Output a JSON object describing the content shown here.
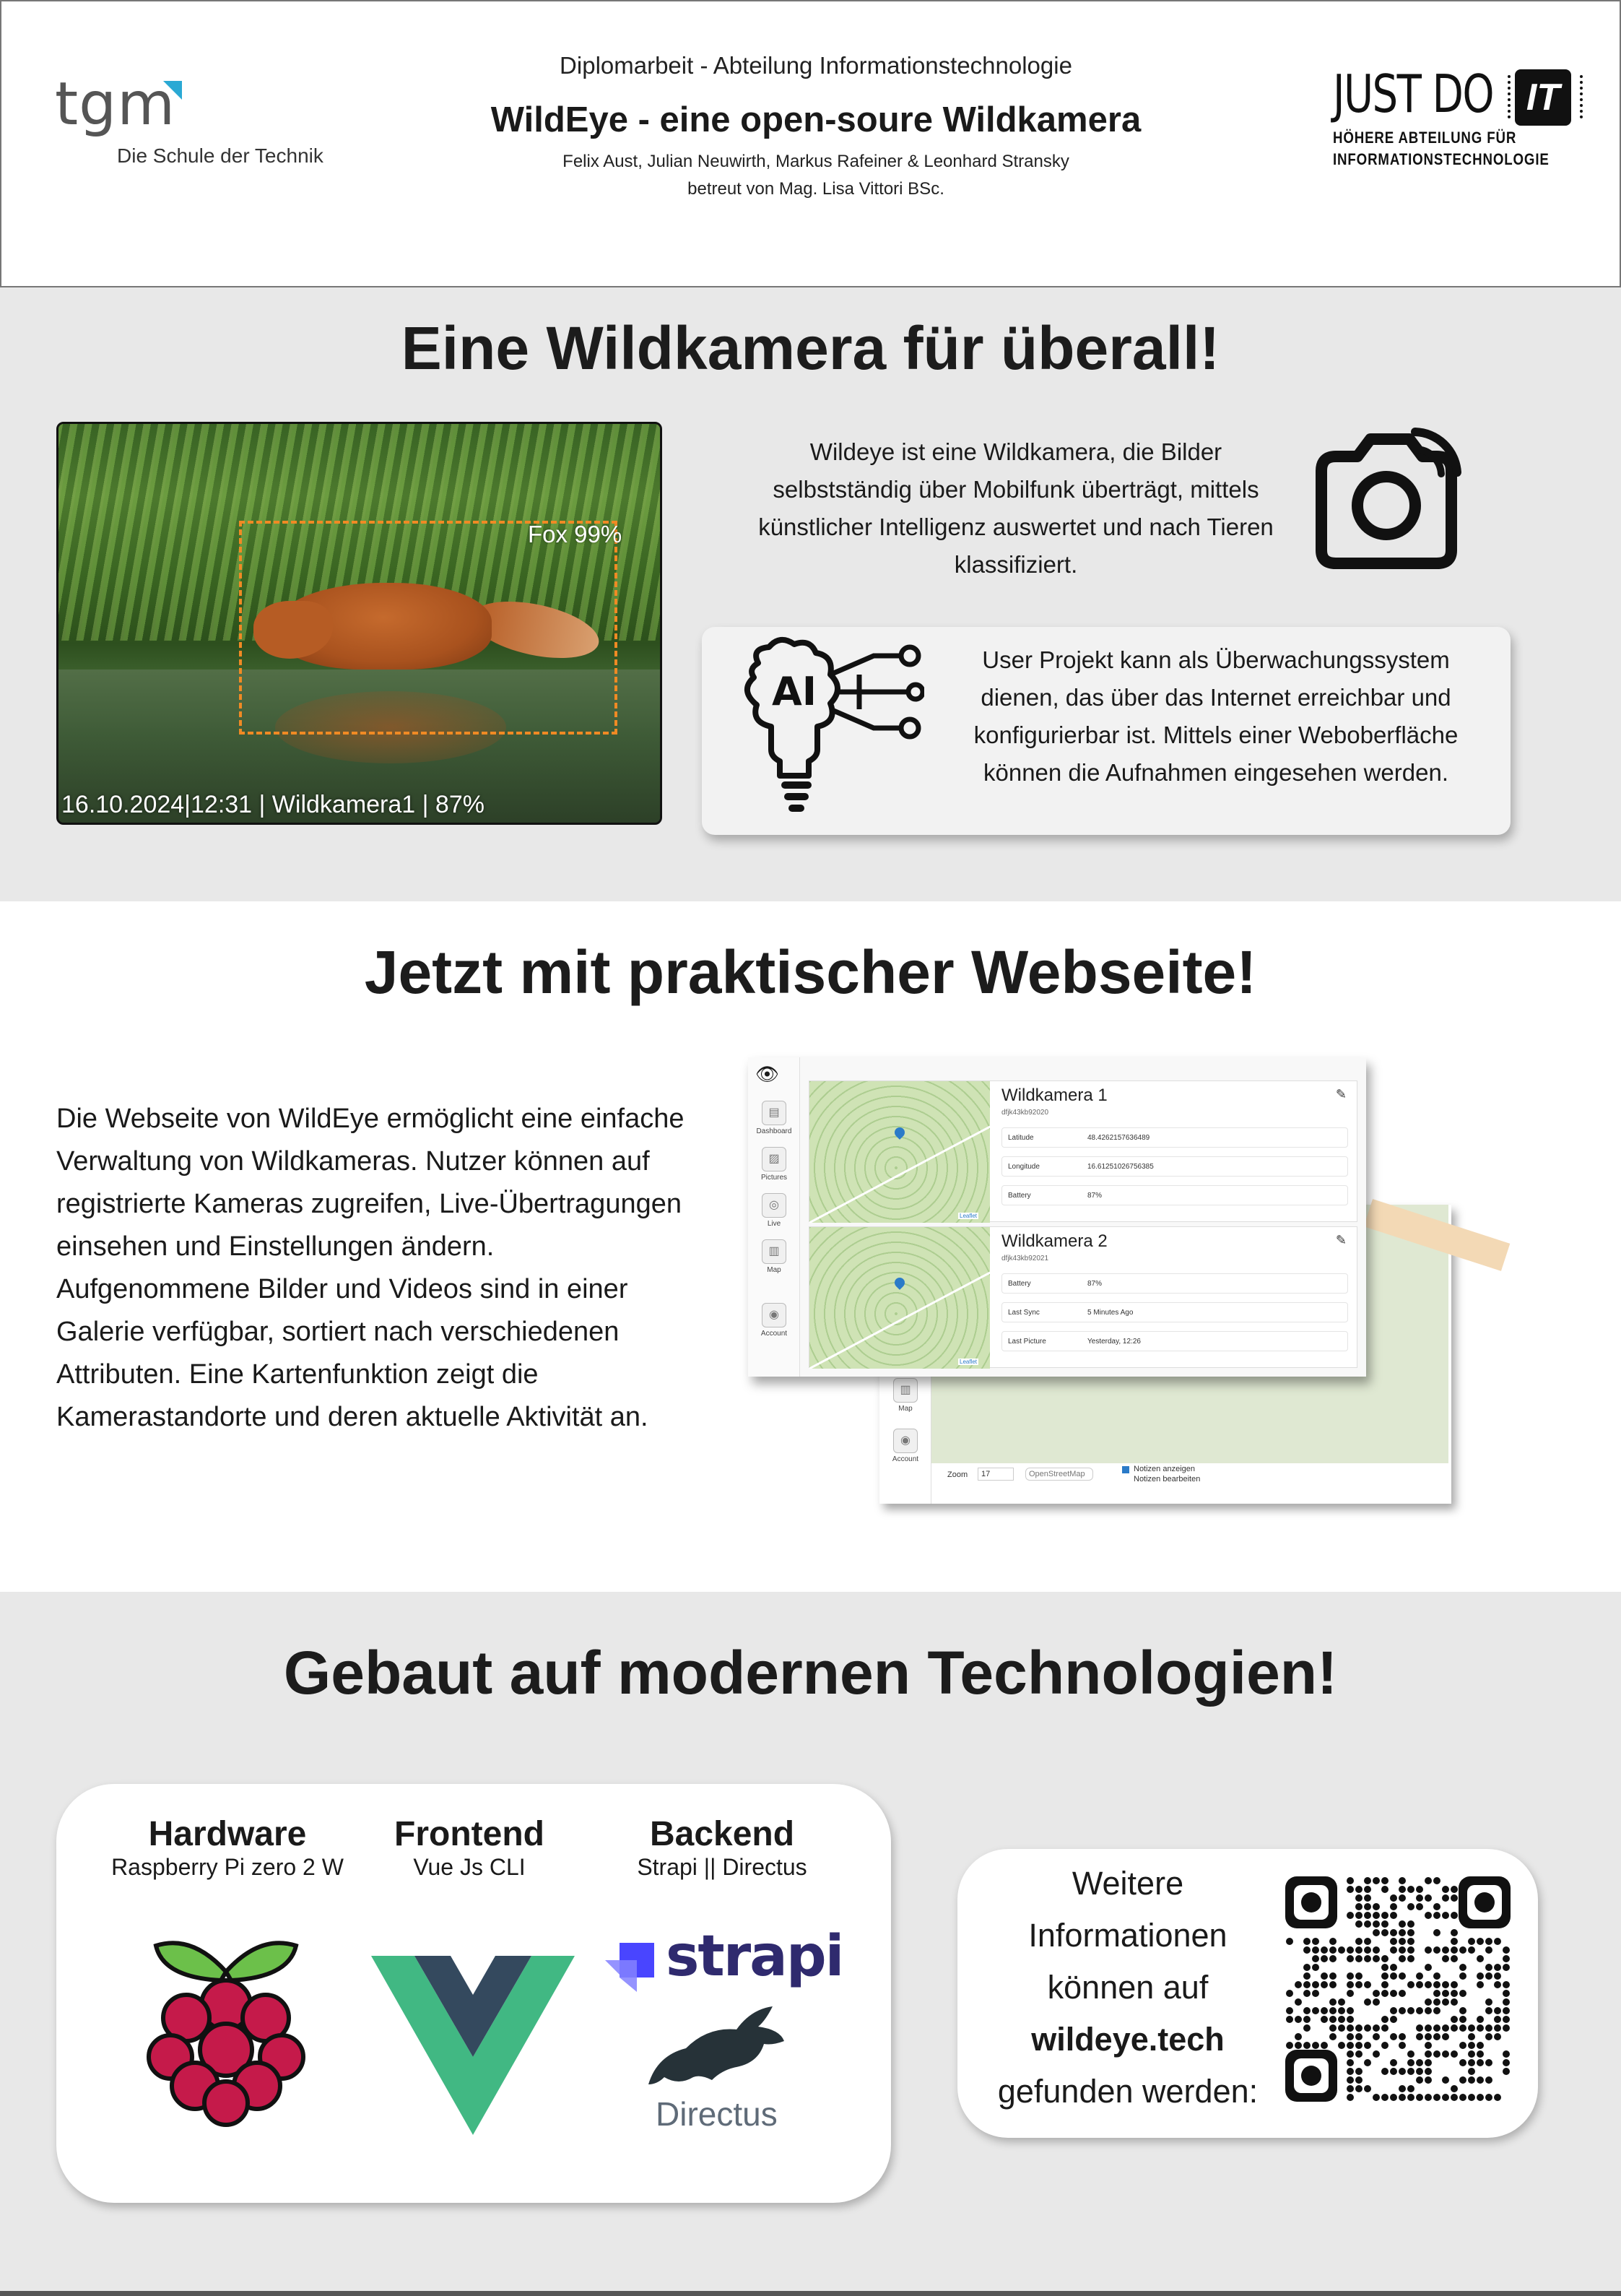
{
  "header": {
    "tgm_logo_text": "tgm",
    "tgm_tagline": "Die Schule der Technik",
    "department": "Diplomarbeit - Abteilung Informationstechnologie",
    "title": "WildEye - eine open-soure Wildkamera",
    "authors": "Felix Aust, Julian Neuwirth, Markus Rafeiner & Leonhard Stransky",
    "supervisor": "betreut von Mag. Lisa Vittori BSc.",
    "jdi_logo_big": "JUST DO",
    "jdi_logo_chip": "IT",
    "jdi_logo_line1": "HÖHERE ABTEILUNG FÜR",
    "jdi_logo_line2": "INFORMATIONSTECHNOLOGIE"
  },
  "section1": {
    "heading": "Eine Wildkamera für überall!",
    "photo_detection_label": "Fox 99%",
    "photo_caption": "16.10.2024|12:31 | Wildkamera1 | 87%",
    "intro_text": "Wildeye ist eine Wildkamera, die Bilder selbstständig über Mobilfunk überträgt, mittels künstlicher Intelligenz auswertet und nach Tieren klassifiziert.",
    "camera_icon": "camera-icon",
    "ai_icon": "ai-lightbulb-icon",
    "ai_icon_text": "AI",
    "ai_text": "User Projekt kann als Überwachungssystem dienen, das über das Internet erreichbar und konfigurierbar ist. Mittels einer Weboberfläche können die Aufnahmen eingesehen werden."
  },
  "section2": {
    "heading": "Jetzt mit praktischer Webseite!",
    "body_lines": [
      "Die Webseite von WildEye ermöglicht eine einfache",
      "Verwaltung von Wildkameras. Nutzer können auf",
      "registrierte Kameras zugreifen, Live-Übertragungen",
      "einsehen und Einstellungen ändern.",
      "Aufgenommene Bilder und Videos sind in einer",
      "Galerie verfügbar, sortiert nach verschiedenen",
      "Attributen. Eine Kartenfunktion zeigt die",
      "Kamerastandorte und deren aktuelle Aktivität an."
    ],
    "screenshot": {
      "sidebar": [
        "Dashboard",
        "Pictures",
        "Live",
        "Map",
        "Account"
      ],
      "back_sidebar": [
        "Map",
        "Account"
      ],
      "cameras": [
        {
          "name": "Wildkamera 1",
          "id": "dfjk43kb92020",
          "rows": [
            {
              "label": "Latitude",
              "value": "48.4262157636489"
            },
            {
              "label": "Longitude",
              "value": "16.61251026756385"
            },
            {
              "label": "Battery",
              "value": "87%"
            }
          ]
        },
        {
          "name": "Wildkamera 2",
          "id": "dfjk43kb92021",
          "rows": [
            {
              "label": "Battery",
              "value": "87%"
            },
            {
              "label": "Last Sync",
              "value": "5 Minutes Ago"
            },
            {
              "label": "Last Picture",
              "value": "Yesterday, 12:26"
            }
          ]
        }
      ],
      "leaflet": "Leaflet",
      "map_zoom_label": "Zoom",
      "map_zoom_value": "17",
      "map_layer": "OpenStreetMap",
      "map_check1": "Notizen anzeigen",
      "map_check2": "Notizen bearbeiten"
    }
  },
  "section3": {
    "heading": "Gebaut auf modernen Technologien!",
    "columns": [
      {
        "title": "Hardware",
        "subtitle": "Raspberry Pi zero 2 W",
        "icon": "raspberry-pi-icon"
      },
      {
        "title": "Frontend",
        "subtitle": "Vue Js CLI",
        "icon": "vue-icon"
      },
      {
        "title": "Backend",
        "subtitle": "Strapi || Directus",
        "icon": "strapi-directus-icon"
      }
    ],
    "strapi_word": "strapi",
    "directus_word": "Directus",
    "info_line1": "Weitere",
    "info_line2": "Informationen",
    "info_line3": "können auf",
    "info_url": "wildeye.tech",
    "info_line5": "gefunden werden:",
    "qr_icon": "qr-code-icon"
  },
  "colors": {
    "section_gray": "#e8e8e8",
    "detection_orange": "#f08a24",
    "tgm_blue": "#2aa9d4",
    "vue_green": "#41b883",
    "vue_dark": "#34495e",
    "raspberry_red": "#c51a4a",
    "strapi_purple": "#4945ff"
  }
}
